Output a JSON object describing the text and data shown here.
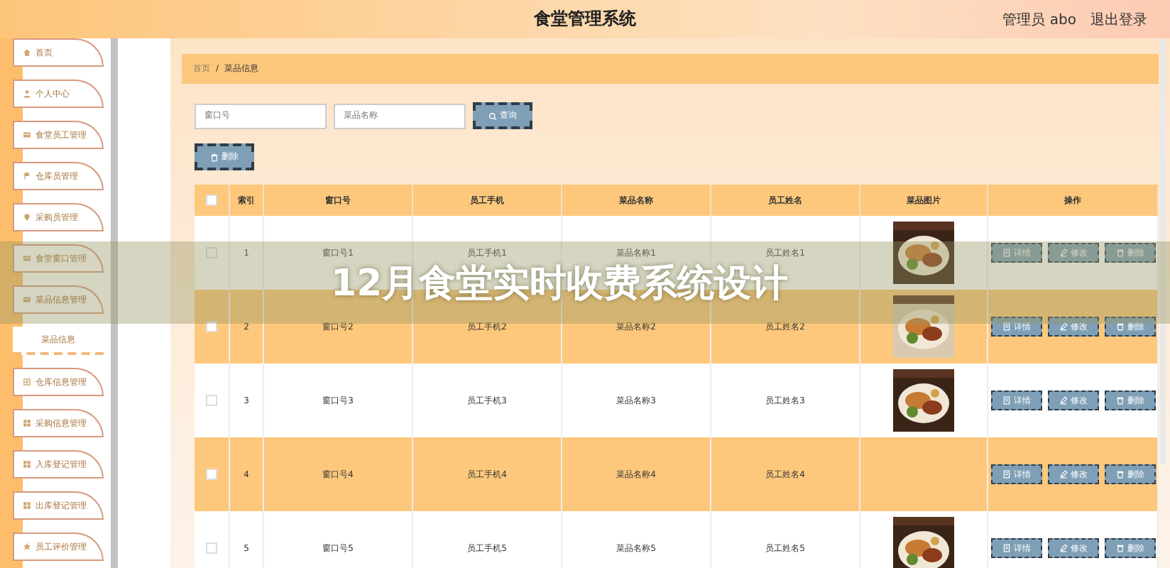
{
  "header": {
    "title": "食堂管理系统",
    "user": "管理员 abo",
    "logout": "退出登录"
  },
  "sidebar": {
    "items": [
      {
        "label": "首页",
        "kind": "menu",
        "selected": false
      },
      {
        "label": "个人中心",
        "kind": "menu",
        "selected": false
      },
      {
        "label": "食堂员工管理",
        "kind": "menu",
        "selected": false
      },
      {
        "label": "仓库员管理",
        "kind": "menu",
        "selected": false
      },
      {
        "label": "采购员管理",
        "kind": "menu",
        "selected": false
      },
      {
        "label": "食堂窗口管理",
        "kind": "menu",
        "selected": false
      },
      {
        "label": "菜品信息管理",
        "kind": "menu",
        "selected": true
      },
      {
        "label": "菜品信息",
        "kind": "sub",
        "selected": false
      },
      {
        "label": "仓库信息管理",
        "kind": "menu",
        "selected": false
      },
      {
        "label": "采购信息管理",
        "kind": "menu",
        "selected": false
      },
      {
        "label": "入库登记管理",
        "kind": "menu",
        "selected": false
      },
      {
        "label": "出库登记管理",
        "kind": "menu",
        "selected": false
      },
      {
        "label": "员工评价管理",
        "kind": "menu",
        "selected": false
      }
    ]
  },
  "breadcrumb": {
    "items": [
      "首页",
      "菜品信息"
    ],
    "separator": "/"
  },
  "search": {
    "fields": [
      {
        "placeholder": "窗口号"
      },
      {
        "placeholder": "菜品名称"
      }
    ],
    "button": "查询"
  },
  "delete_button": "删除",
  "banner": "12月食堂实时收费系统设计",
  "table": {
    "select_all_checked": false,
    "columns": [
      "索引",
      "窗口号",
      "员工手机",
      "菜品名称",
      "员工姓名",
      "菜品图片",
      "操作"
    ],
    "rows": [
      {
        "index": "1",
        "window": "窗口号1",
        "phone": "员工手机1",
        "dish": "菜品名称1",
        "name": "员工姓名1",
        "picture": true,
        "checked": false,
        "actions": [
          "详情",
          "修改",
          "删除"
        ]
      },
      {
        "index": "2",
        "window": "窗口号2",
        "phone": "员工手机2",
        "dish": "菜品名称2",
        "name": "员工姓名2",
        "picture": true,
        "checked": false,
        "actions": [
          "详情",
          "修改",
          "删除"
        ]
      },
      {
        "index": "3",
        "window": "窗口号3",
        "phone": "员工手机3",
        "dish": "菜品名称3",
        "name": "员工姓名3",
        "picture": true,
        "checked": false,
        "actions": [
          "详情",
          "修改",
          "删除"
        ]
      },
      {
        "index": "4",
        "window": "窗口号4",
        "phone": "员工手机4",
        "dish": "菜品名称4",
        "name": "员工姓名4",
        "picture": false,
        "checked": false,
        "actions": [
          "详情",
          "修改",
          "删除"
        ]
      },
      {
        "index": "5",
        "window": "窗口号5",
        "phone": "员工手机5",
        "dish": "菜品名称5",
        "name": "员工姓名5",
        "picture": true,
        "checked": false,
        "actions": [
          "详情",
          "修改",
          "删除"
        ]
      }
    ]
  }
}
